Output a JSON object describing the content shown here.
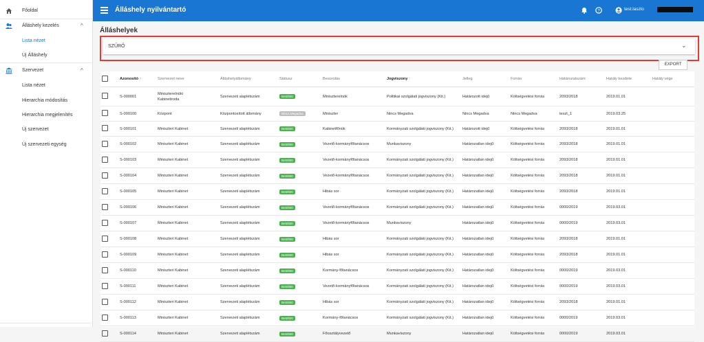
{
  "sidebar": {
    "items": [
      {
        "label": "Főoldal",
        "icon": "home-icon"
      },
      {
        "label": "Álláshely kezelés",
        "icon": "people-icon",
        "chevron": "^"
      },
      {
        "label": "Lista nézet",
        "active": true
      },
      {
        "label": "Új Álláshely"
      },
      {
        "label": "Szervezet",
        "icon": "bank-icon",
        "chevron": "^"
      },
      {
        "label": "Lista nézet"
      },
      {
        "label": "Hierarchia módosítás"
      },
      {
        "label": "Hierarchia megjelenítés"
      },
      {
        "label": "Új szervezet"
      },
      {
        "label": "Új szervezeti egység"
      }
    ]
  },
  "appbar": {
    "title": "Álláshely nyilvántartó",
    "user": "test.laszlo"
  },
  "page": {
    "title": "Álláshelyek",
    "filter_label": "SZŰRŐ",
    "export_label": "EXPORT"
  },
  "table": {
    "columns": [
      "Azonosító",
      "Szervezet neve",
      "Álláshelyállomány",
      "Státusz",
      "Besorolás",
      "Jogviszony",
      "Jelleg",
      "Forrás",
      "Határozatszám",
      "Hatály kezdete",
      "Hatály vége"
    ],
    "rows": [
      [
        "S-000001",
        "Miniszterelnöki Kabinetiroda",
        "Szervezeti alaplétszám",
        "Betöltött",
        "Miniszterelnök",
        "Politikai szolgálati jogviszony (Kit.)",
        "Határozott idejű",
        "Költségvetési forrás",
        "2093/2018",
        "2019.01.01",
        ""
      ],
      [
        "S-000100",
        "Központ",
        "Központosított állomány",
        "Nincs Megadva",
        "Miniszter",
        "Nincs Megadva",
        "Nincs Megadva",
        "Nincs Megadva",
        "teszt_1",
        "2019.03.25",
        ""
      ],
      [
        "S-000101",
        "Miniszteri Kabinet",
        "Szervezeti alaplétszám",
        "Betöltött",
        "Kabinetfőnök",
        "Kormányzati szolgálati jogviszony (Kit.)",
        "Határozott idejű",
        "Költségvetési forrás",
        "2093/2018",
        "2019.01.01",
        ""
      ],
      [
        "S-000102",
        "Miniszteri Kabinet",
        "Szervezeti alaplétszám",
        "Betöltött",
        "Vezető-kormányfőtanácsos",
        "Munkaviszony",
        "Határozatlan idejű",
        "Költségvetési forrás",
        "2093/2018",
        "2019.01.01",
        ""
      ],
      [
        "S-000103",
        "Miniszteri Kabinet",
        "Szervezeti alaplétszám",
        "Betöltött",
        "Vezető-kormányfőtanácsos",
        "Kormányzati szolgálati jogviszony (Kit.)",
        "Határozatlan idejű",
        "Költségvetési forrás",
        "2093/2018",
        "2019.01.01",
        ""
      ],
      [
        "S-000104",
        "Miniszteri Kabinet",
        "Szervezeti alaplétszám",
        "Betöltött",
        "Vezető-kormányfőtanácsos",
        "Kormányzati szolgálati jogviszony (Kit.)",
        "Határozatlan idejű",
        "Költségvetési forrás",
        "2093/2018",
        "2019.01.01",
        ""
      ],
      [
        "S-000105",
        "Miniszteri Kabinet",
        "Szervezeti alaplétszám",
        "Betöltött",
        "Hibás sor",
        "Kormányzati szolgálati jogviszony (Kit.)",
        "Határozatlan idejű",
        "Költségvetési forrás",
        "2093/2018",
        "2019.01.01",
        ""
      ],
      [
        "S-000106",
        "Miniszteri Kabinet",
        "Szervezeti alaplétszám",
        "Betöltött",
        "Vezető-kormányfőtanácsos",
        "Kormányzati szolgálati jogviszony (Kit.)",
        "Határozatlan idejű",
        "Költségvetési forrás",
        "0000/2019",
        "2019.03.01",
        ""
      ],
      [
        "S-000107",
        "Miniszteri Kabinet",
        "Szervezeti alaplétszám",
        "Betöltött",
        "Vezető-kormányfőtanácsos",
        "Munkaviszony",
        "Határozatlan idejű",
        "Költségvetési forrás",
        "0000/2019",
        "2019.03.01",
        ""
      ],
      [
        "S-000108",
        "Miniszteri Kabinet",
        "Szervezeti alaplétszám",
        "Betöltött",
        "Hibás sor",
        "Kormányzati szolgálati jogviszony (Kit.)",
        "Határozatlan idejű",
        "Költségvetési forrás",
        "2093/2018",
        "2019.01.01",
        ""
      ],
      [
        "S-000109",
        "Miniszteri Kabinet",
        "Szervezeti alaplétszám",
        "Betöltött",
        "Hibás sor",
        "Kormányzati szolgálati jogviszony (Kit.)",
        "Határozatlan idejű",
        "Költségvetési forrás",
        "2093/2018",
        "2019.01.01",
        ""
      ],
      [
        "S-000110",
        "Miniszteri Kabinet",
        "Szervezeti alaplétszám",
        "Betöltött",
        "Kormány-főtanácsos",
        "Kormányzati szolgálati jogviszony (Kit.)",
        "Határozatlan idejű",
        "Költségvetési forrás",
        "0000/2019",
        "2019.03.01",
        ""
      ],
      [
        "S-000111",
        "Miniszteri Kabinet",
        "Szervezeti alaplétszám",
        "Betöltött",
        "Vezető-kormányfőtanácsos",
        "Kormányzati szolgálati jogviszony (Kit.)",
        "Határozatlan idejű",
        "Költségvetési forrás",
        "0000/2019",
        "2019.03.01",
        ""
      ],
      [
        "S-000112",
        "Miniszteri Kabinet",
        "Szervezeti alaplétszám",
        "Betöltött",
        "Hibás sor",
        "Kormányzati szolgálati jogviszony (Kit.)",
        "Határozatlan idejű",
        "Költségvetési forrás",
        "2093/2018",
        "2019.01.01",
        ""
      ],
      [
        "S-000113",
        "Miniszteri Kabinet",
        "Szervezeti alaplétszám",
        "Betöltött",
        "Kormány-főtanácsos",
        "Kormányzati szolgálati jogviszony (Kit.)",
        "Határozatlan idejű",
        "Költségvetési forrás",
        "0000/2019",
        "2019.03.01",
        ""
      ],
      [
        "S-000114",
        "Miniszteri Kabinet",
        "Szervezeti alaplétszám",
        "Betöltött",
        "Főosztályvezető",
        "Munkaviszony",
        "Határozatlan idejű",
        "Költségvetési forrás",
        "0000/2019",
        "2019.03.01",
        ""
      ]
    ]
  },
  "colors": {
    "primary": "#1976d2",
    "badge_filled": "#4caf50",
    "badge_none": "#bdbdbd",
    "highlight": "#e53935"
  }
}
